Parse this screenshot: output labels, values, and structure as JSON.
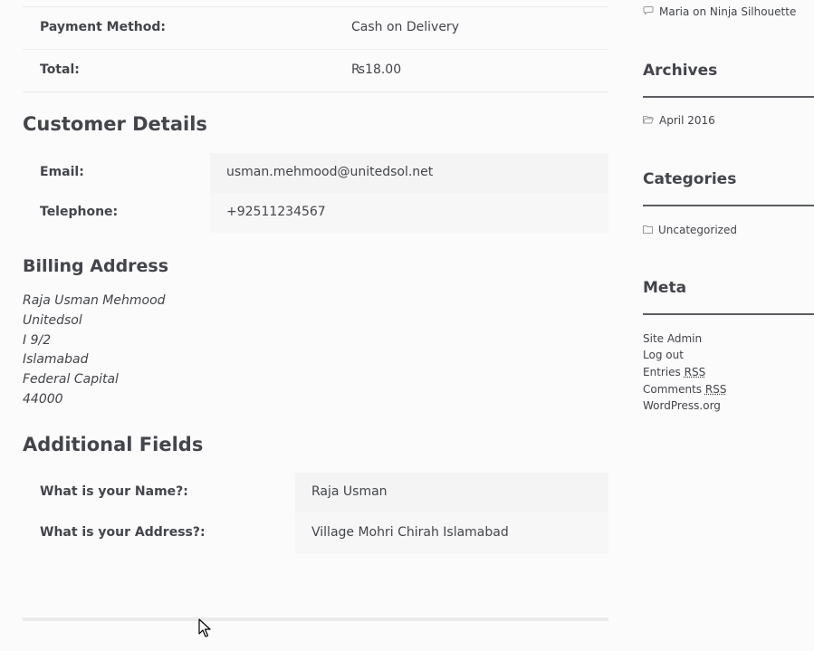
{
  "order": {
    "payment_method_label": "Payment Method:",
    "payment_method_value": "Cash on Delivery",
    "total_label": "Total:",
    "total_value": "₨18.00"
  },
  "customer": {
    "heading": "Customer Details",
    "email_label": "Email:",
    "email_value": "usman.mehmood@unitedsol.net",
    "phone_label": "Telephone:",
    "phone_value": "+92511234567"
  },
  "billing": {
    "heading": "Billing Address",
    "lines": [
      "Raja Usman Mehmood",
      "Unitedsol",
      "I 9/2",
      "Islamabad",
      "Federal Capital",
      "44000"
    ]
  },
  "additional": {
    "heading": "Additional Fields",
    "name_label": "What is your Name?:",
    "name_value": "Raja Usman",
    "address_label": "What is your Address?:",
    "address_value": "Village Mohri Chirah Islamabad"
  },
  "sidebar": {
    "recent_comment": "Maria on Ninja Silhouette",
    "archives_title": "Archives",
    "archives_item": "April 2016",
    "categories_title": "Categories",
    "categories_item": "Uncategorized",
    "meta_title": "Meta",
    "meta_links": {
      "site_admin": "Site Admin",
      "log_out": "Log out",
      "entries_prefix": "Entries",
      "comments_prefix": "Comments",
      "rss": "RSS",
      "wordpress": "WordPress.org"
    }
  }
}
